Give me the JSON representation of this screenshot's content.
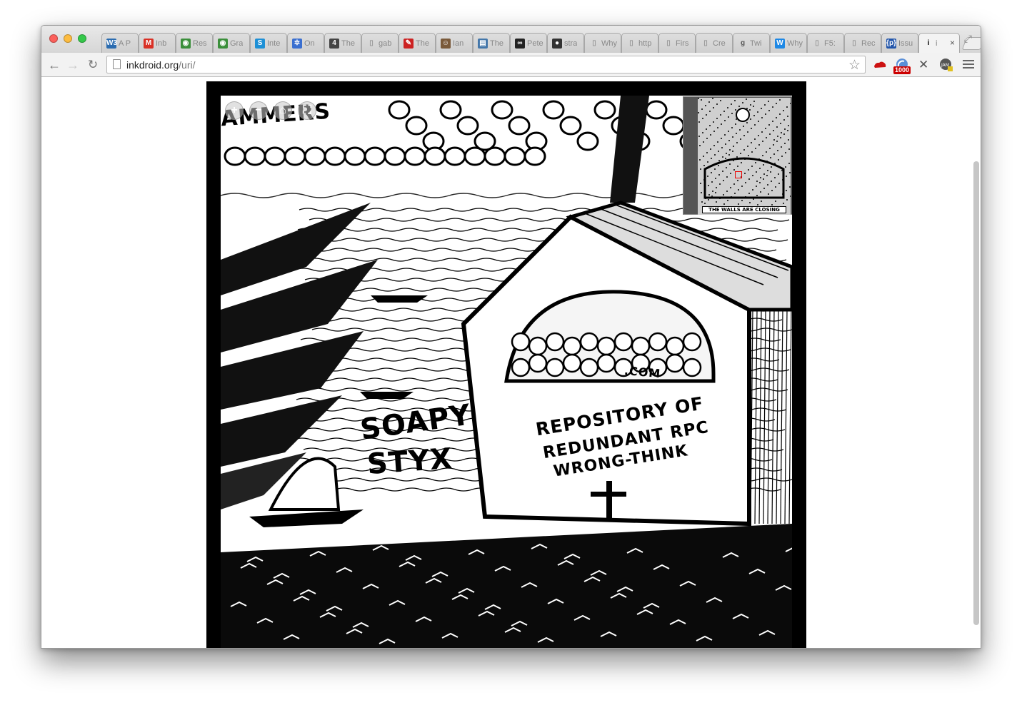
{
  "browser": {
    "tabs": [
      {
        "icon": "w3c-icon",
        "title": "A P",
        "color": "#2b6cb0",
        "glyph": "W3"
      },
      {
        "icon": "gmail-icon",
        "title": "Inb",
        "color": "#d93025",
        "glyph": "M"
      },
      {
        "icon": "globe-icon",
        "title": "Res",
        "color": "#3b8f3b",
        "glyph": "◉"
      },
      {
        "icon": "globe-icon",
        "title": "Gra",
        "color": "#3b8f3b",
        "glyph": "◉"
      },
      {
        "icon": "s-icon",
        "title": "Inte",
        "color": "#1e90d6",
        "glyph": "S"
      },
      {
        "icon": "network-icon",
        "title": "On",
        "color": "#3a6fd0",
        "glyph": "✲"
      },
      {
        "icon": "html5-icon",
        "title": "The",
        "color": "#444444",
        "glyph": "4"
      },
      {
        "icon": "page-icon",
        "title": "gab",
        "color": "#999999",
        "glyph": "▯"
      },
      {
        "icon": "red-book-icon",
        "title": "The",
        "color": "#cc2222",
        "glyph": "✎"
      },
      {
        "icon": "avatar-icon",
        "title": "Ian",
        "color": "#7a5a3a",
        "glyph": "☺"
      },
      {
        "icon": "book-icon",
        "title": "The",
        "color": "#4477aa",
        "glyph": "▤"
      },
      {
        "icon": "link-icon",
        "title": "Pete",
        "color": "#222222",
        "glyph": "∞"
      },
      {
        "icon": "github-icon",
        "title": "stra",
        "color": "#333333",
        "glyph": "●"
      },
      {
        "icon": "page-icon",
        "title": "Why",
        "color": "#999999",
        "glyph": "▯"
      },
      {
        "icon": "page-icon",
        "title": "http",
        "color": "#999999",
        "glyph": "▯"
      },
      {
        "icon": "page-icon",
        "title": "Firs",
        "color": "#999999",
        "glyph": "▯"
      },
      {
        "icon": "page-icon",
        "title": "Cre",
        "color": "#999999",
        "glyph": "▯"
      },
      {
        "icon": "goodreads-icon",
        "title": "Twi",
        "color": "#555555",
        "glyph": "g"
      },
      {
        "icon": "wikipedia-icon",
        "title": "Why",
        "color": "#1e88e5",
        "glyph": "W"
      },
      {
        "icon": "page-icon",
        "title": "F5:",
        "color": "#999999",
        "glyph": "▯"
      },
      {
        "icon": "page-icon",
        "title": "Rec",
        "color": "#999999",
        "glyph": "▯"
      },
      {
        "icon": "python-icon",
        "title": "Issu",
        "color": "#2255aa",
        "glyph": "{p}"
      },
      {
        "icon": "info-icon",
        "title": "i",
        "color": "#000000",
        "glyph": "i",
        "active": true
      }
    ],
    "address": {
      "host": "inkdroid.org",
      "path": "/uri/"
    },
    "extensions": {
      "feed_badge": "1000",
      "jam_label": "JAM"
    }
  },
  "viewer": {
    "controls": [
      "+",
      "−",
      "⌂",
      "⛶"
    ],
    "navigator_caption": "THE WALLS ARE CLOSING",
    "artwork": {
      "text_top": "AMMERS",
      "text_soapy": "SOAPY",
      "text_styx": "STYX",
      "building_sign": "REPOSITORY OF REDUNDANT RPC WRONG-THINK",
      "sign_line1": "REPOSITORY OF",
      "sign_line2": "REDUNDANT RPC",
      "sign_line3": "WRONG-THINK",
      "window_text": ".COM"
    }
  }
}
